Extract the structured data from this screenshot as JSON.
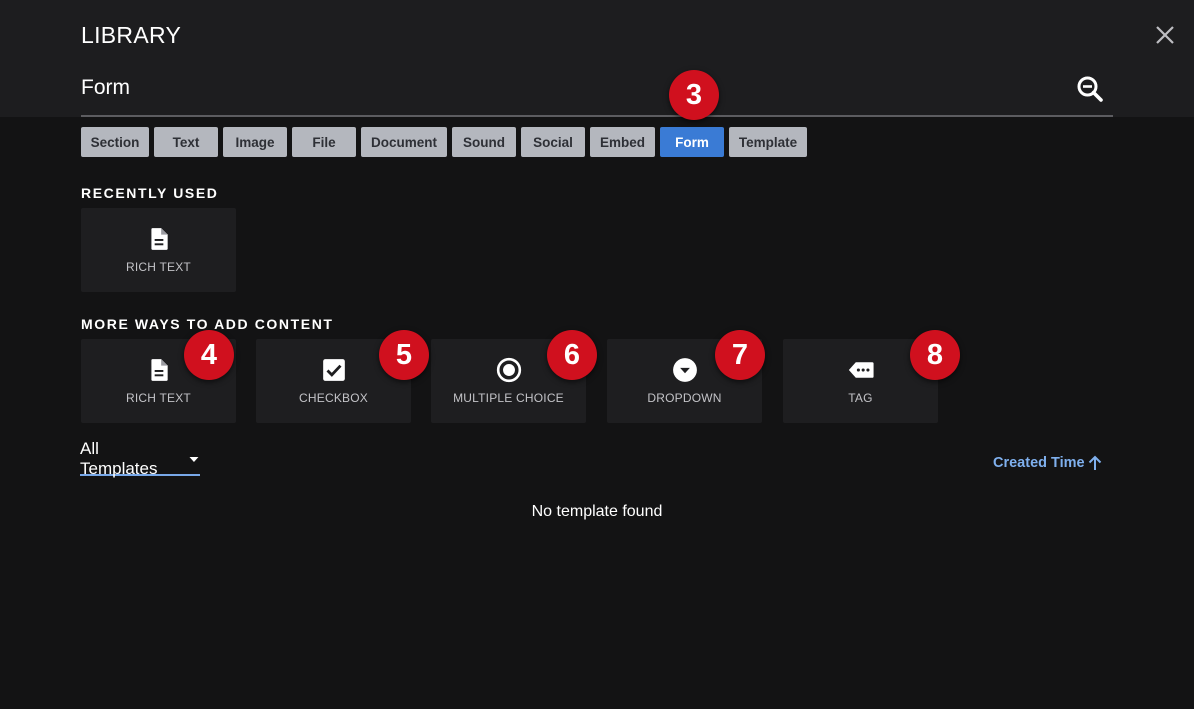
{
  "header": {
    "title": "LIBRARY",
    "close_icon": "close-icon"
  },
  "search": {
    "value": "Form",
    "icon": "zoom-out-magnifier-icon"
  },
  "tabs": [
    {
      "label": "Section",
      "active": false
    },
    {
      "label": "Text",
      "active": false
    },
    {
      "label": "Image",
      "active": false
    },
    {
      "label": "File",
      "active": false
    },
    {
      "label": "Document",
      "active": false
    },
    {
      "label": "Sound",
      "active": false
    },
    {
      "label": "Social",
      "active": false
    },
    {
      "label": "Embed",
      "active": false
    },
    {
      "label": "Form",
      "active": true
    },
    {
      "label": "Template",
      "active": false
    }
  ],
  "recently_used": {
    "title": "RECENTLY USED",
    "items": [
      {
        "label": "RICH TEXT",
        "icon": "document-icon"
      }
    ]
  },
  "more_ways": {
    "title": "MORE WAYS TO ADD CONTENT",
    "items": [
      {
        "label": "RICH TEXT",
        "icon": "document-icon"
      },
      {
        "label": "CHECKBOX",
        "icon": "checkbox-icon"
      },
      {
        "label": "MULTIPLE CHOICE",
        "icon": "radio-button-icon"
      },
      {
        "label": "DROPDOWN",
        "icon": "dropdown-circle-icon"
      },
      {
        "label": "TAG",
        "icon": "tag-icon"
      }
    ]
  },
  "badges": [
    "3",
    "4",
    "5",
    "6",
    "7",
    "8"
  ],
  "templates": {
    "filter_label": "All Templates",
    "sort_label": "Created Time",
    "empty_message": "No template found"
  },
  "colors": {
    "accent": "#3a7bd5",
    "badge": "#d0101e",
    "link": "#7fb0ee",
    "tab_inactive": "#b4b7be"
  }
}
